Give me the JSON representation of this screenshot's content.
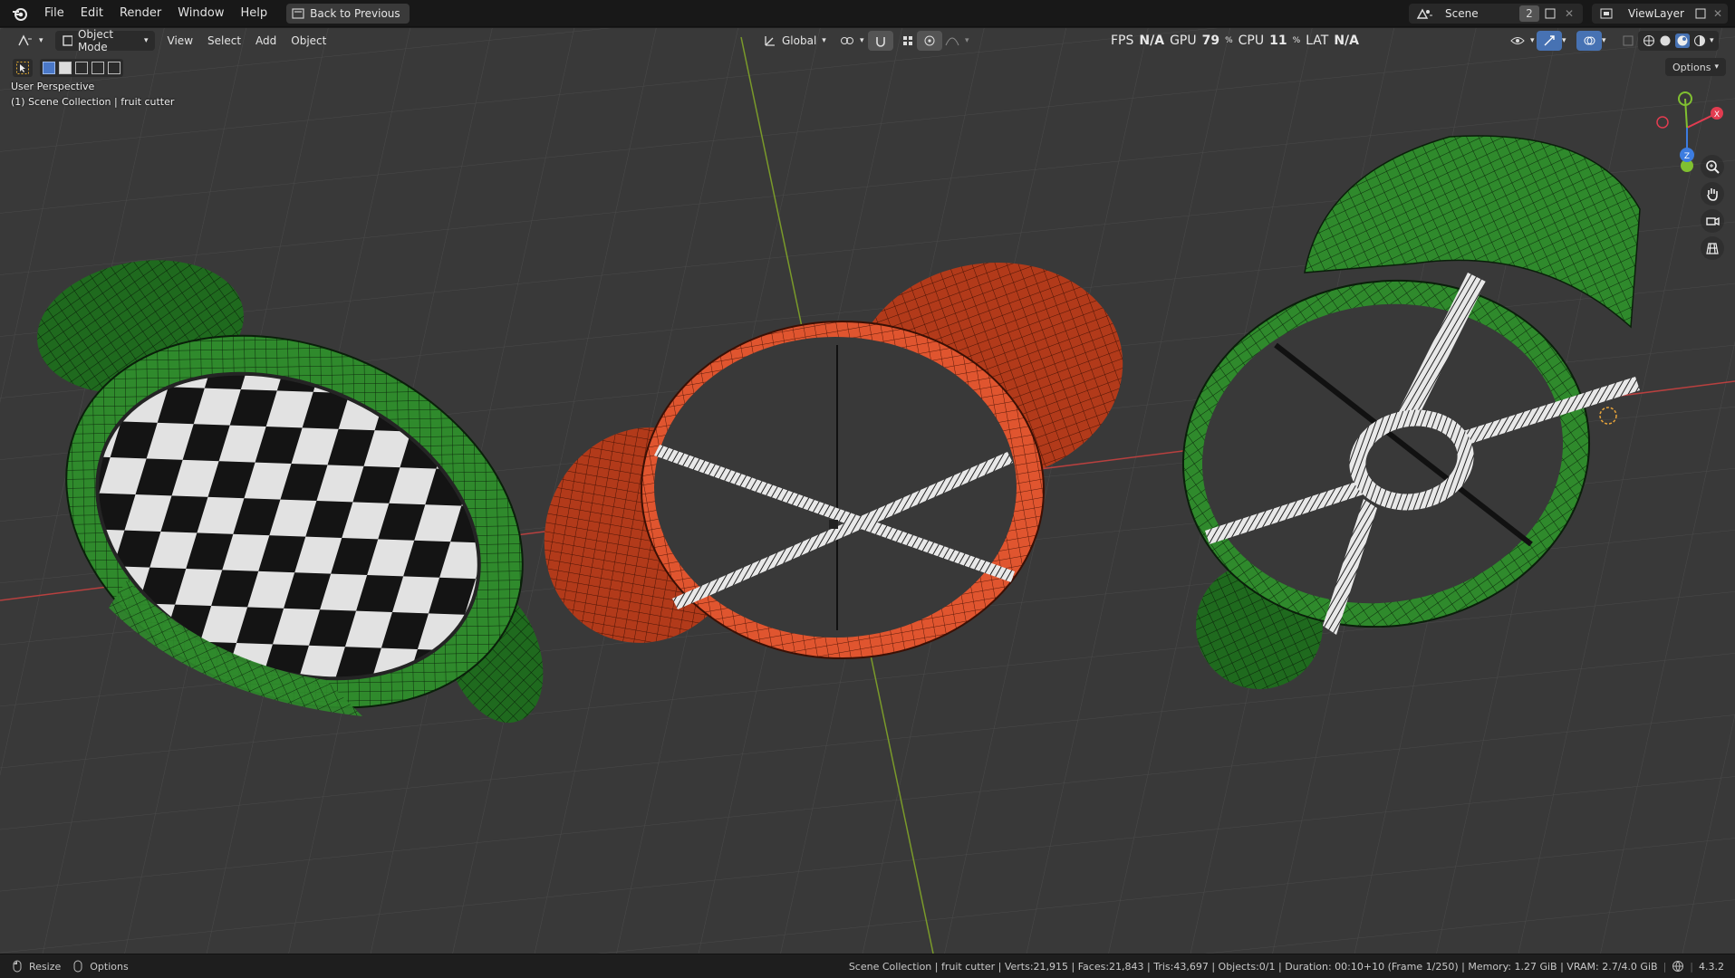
{
  "menu": {
    "items": [
      "File",
      "Edit",
      "Render",
      "Window",
      "Help"
    ],
    "back_button": "Back to Previous"
  },
  "scene_selector": {
    "label": "Scene",
    "count": "2"
  },
  "view_layer": {
    "label": "ViewLayer"
  },
  "header": {
    "mode": "Object Mode",
    "view": "View",
    "select": "Select",
    "add": "Add",
    "object": "Object",
    "transform_orientation": "Global"
  },
  "perf": {
    "fps_label": "FPS",
    "fps_value": "N/A",
    "gpu_label": "GPU",
    "gpu_value": "79",
    "cpu_label": "CPU",
    "cpu_value": "11",
    "percent": "%",
    "lat_label": "LAT",
    "lat_value": "N/A"
  },
  "viewport": {
    "perspective": "User Perspective",
    "collection": "(1) Scene Collection | fruit cutter",
    "options": "Options"
  },
  "gizmo": {
    "x": "X",
    "y": "Y",
    "z": "Z"
  },
  "status": {
    "resize": "Resize",
    "options": "Options",
    "stats": "Scene Collection | fruit cutter | Verts:21,915 | Faces:21,843 | Tris:43,697 | Objects:0/1 | Duration: 00:10+10 (Frame 1/250) | Memory: 1.27 GiB | VRAM: 2.7/4.0 GiB",
    "version": "4.3.2"
  },
  "colors": {
    "viewport_bg": "#393939",
    "green_mesh": "#2f8a2c",
    "red_mesh": "#e0552f",
    "x_axis": "#b8403f",
    "y_axis": "#7a9a2a"
  },
  "icons": [
    "blender-logo",
    "back-icon",
    "scene-icon",
    "viewlayer-icon",
    "zoom-icon",
    "hand-icon",
    "camera-icon",
    "grid-icon",
    "select-box-icon",
    "transform-icon",
    "snap-icon",
    "proportional-icon",
    "overlay-icon",
    "shading-icon"
  ]
}
